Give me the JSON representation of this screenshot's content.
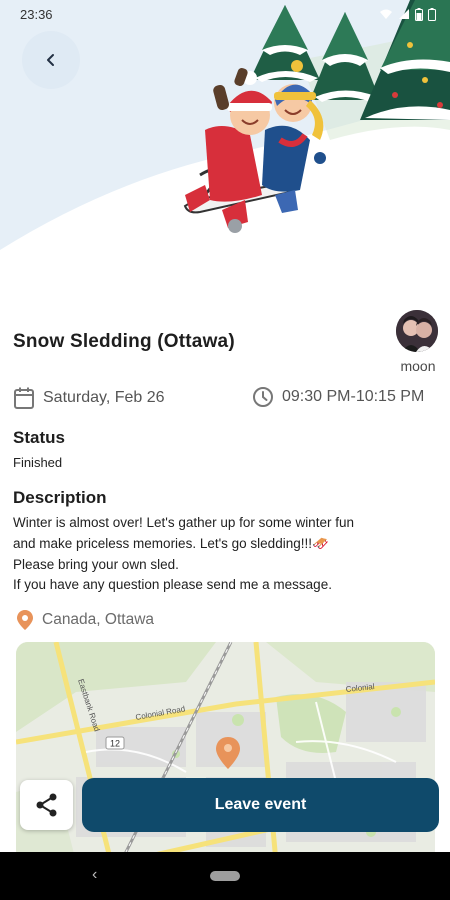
{
  "status_bar": {
    "time": "23:36"
  },
  "header": {
    "back_icon": "chevron-left-icon"
  },
  "event": {
    "title": "Snow Sledding (Ottawa)",
    "host": {
      "name": "moon"
    },
    "date": "Saturday, Feb 26",
    "time_range": "09:30 PM-10:15 PM",
    "status_label": "Status",
    "status_value": "Finished",
    "description_label": "Description",
    "description_lines": [
      "Winter is almost over! Let's gather up for some winter fun",
      "and make priceless memories. Let's go sledding!!!🛷",
      "Please bring your own sled.",
      "If you have any question please send me a message."
    ],
    "location": "Canada, Ottawa"
  },
  "map": {
    "label_number": "12",
    "road_labels": [
      "Eastbank Road",
      "Colonial Road",
      "Colonial"
    ]
  },
  "actions": {
    "share_icon": "share-icon",
    "leave_label": "Leave event"
  },
  "colors": {
    "primary": "#0f4a6b",
    "pin": "#e8935a",
    "accent_icon": "#777777"
  }
}
